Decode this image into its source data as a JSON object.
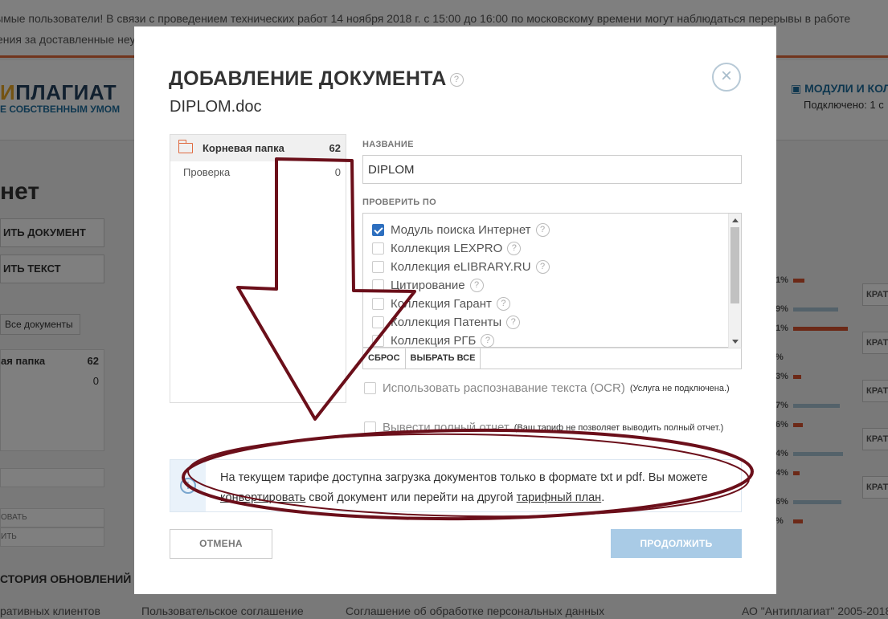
{
  "background": {
    "banner": {
      "line1": "ымые пользователи! В связи с проведением технических работ 14 ноября 2018 г. с 15:00 до 16:00 по московскому времени могут наблюдаться перерывы в работе",
      "line2": "ения за доставленные неу"
    },
    "logo": {
      "accent": "И",
      "rest": "ПЛАГИАТ",
      "subtitle": "Е СОБСТВЕННЫМ УМОМ"
    },
    "modules": {
      "label": "МОДУЛИ И КОЛ",
      "status": "Подключено: 1 с"
    },
    "page_title": "нет",
    "buttons": {
      "add_document": "ИТЬ ДОКУМЕНТ",
      "add_text": "ИТЬ ТЕКСТ",
      "all_documents": "Все документы"
    },
    "folders": {
      "root_name": "ая папка",
      "root_count": "62",
      "sub_count": "0"
    },
    "side_items": [
      "ОВАТЬ",
      "ИТЬ"
    ],
    "history": "СТОРИЯ ОБНОВЛЕНИЙ",
    "footer": {
      "clients": "ративных клиентов",
      "agreement": "Пользовательское соглашение",
      "privacy": "Соглашение об обработке персональных данных",
      "copyright": "АО \"Антиплагиат\" 2005-2018"
    },
    "report_rows": [
      {
        "pct_a": "1%",
        "pct_b": "9%",
        "button": "КРАТ"
      },
      {
        "pct_a": "1%",
        "pct_b": "%",
        "button": "КРАТ"
      },
      {
        "pct_a": "3%",
        "pct_b": "7%",
        "button": "КРАТ"
      },
      {
        "pct_a": "6%",
        "pct_b": "4%",
        "button": "КРАТ"
      },
      {
        "pct_a": "4%",
        "pct_b": "6%",
        "button": "КРАТ"
      },
      {
        "pct_a": "%",
        "pct_b": "",
        "button": ""
      }
    ]
  },
  "modal": {
    "title": "ДОБАВЛЕНИЕ ДОКУМЕНТА",
    "file_name": "DIPLOM.doc",
    "close_symbol": "×",
    "help_symbol": "?",
    "folders": [
      {
        "name": "Корневая папка",
        "count": "62"
      },
      {
        "name": "Проверка",
        "count": "0"
      }
    ],
    "name_label": "НАЗВАНИЕ",
    "name_value": "DIPLOM",
    "check_label": "ПРОВЕРИТЬ ПО",
    "check_items": [
      {
        "label": "Модуль поиска Интернет",
        "checked": true
      },
      {
        "label": "Коллекция LEXPRO",
        "checked": false
      },
      {
        "label": "Коллекция eLIBRARY.RU",
        "checked": false
      },
      {
        "label": "Цитирование",
        "checked": false
      },
      {
        "label": "Коллекция Гарант",
        "checked": false
      },
      {
        "label": "Коллекция Патенты",
        "checked": false
      },
      {
        "label": "Коллекция РГБ",
        "checked": false
      }
    ],
    "reset_label": "СБРОС",
    "select_all_label": "ВЫБРАТЬ ВСЕ",
    "ocr_label": "Использовать распознавание текста (OCR)",
    "ocr_note": "(Услуга не подключена.)",
    "report_label": "Вывести полный отчет",
    "report_note": "(Ваш тариф не позволяет выводить полный отчет.)",
    "info": {
      "icon_symbol": "i",
      "text_1": "На текущем тарифе доступна загрузка документов только в формате txt и pdf. Вы можете",
      "link_convert": "конвертировать",
      "text_2": " свой документ или перейти на другой ",
      "link_tariff": "тарифный план",
      "text_3": "."
    },
    "cancel_label": "ОТМЕНА",
    "continue_label": "ПРОДОЛЖИТЬ"
  },
  "annotation": {
    "color": "#6b0f1a",
    "shapes": [
      "arrow-down",
      "ellipse"
    ]
  }
}
